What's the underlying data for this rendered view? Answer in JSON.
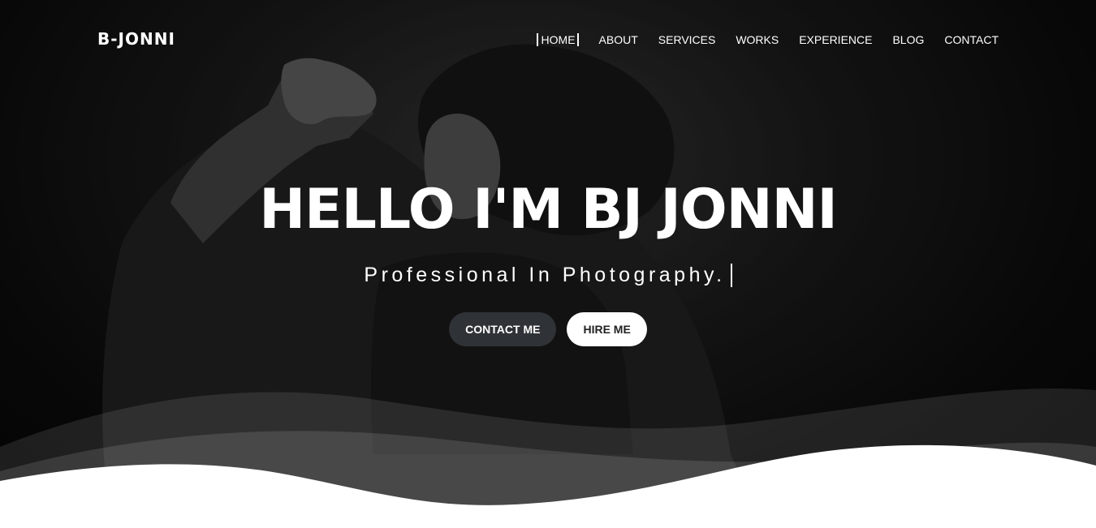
{
  "brand": "B-JONNI",
  "nav": {
    "items": [
      {
        "label": "HOME",
        "active": true
      },
      {
        "label": "ABOUT"
      },
      {
        "label": "SERVICES"
      },
      {
        "label": "WORKS"
      },
      {
        "label": "EXPERIENCE"
      },
      {
        "label": "BLOG"
      },
      {
        "label": "CONTACT"
      }
    ]
  },
  "hero": {
    "headline": "HELLO I'M BJ JONNI",
    "tagline": "Professional In Photography.",
    "buttons": {
      "contact_label": "CONTACT ME",
      "hire_label": "HIRE ME"
    },
    "background_image": "black-and-white-portrait-photo"
  },
  "colors": {
    "text": "#ffffff",
    "button_dark": "#2f3236",
    "button_light": "#ffffff",
    "page_bottom": "#ffffff"
  }
}
